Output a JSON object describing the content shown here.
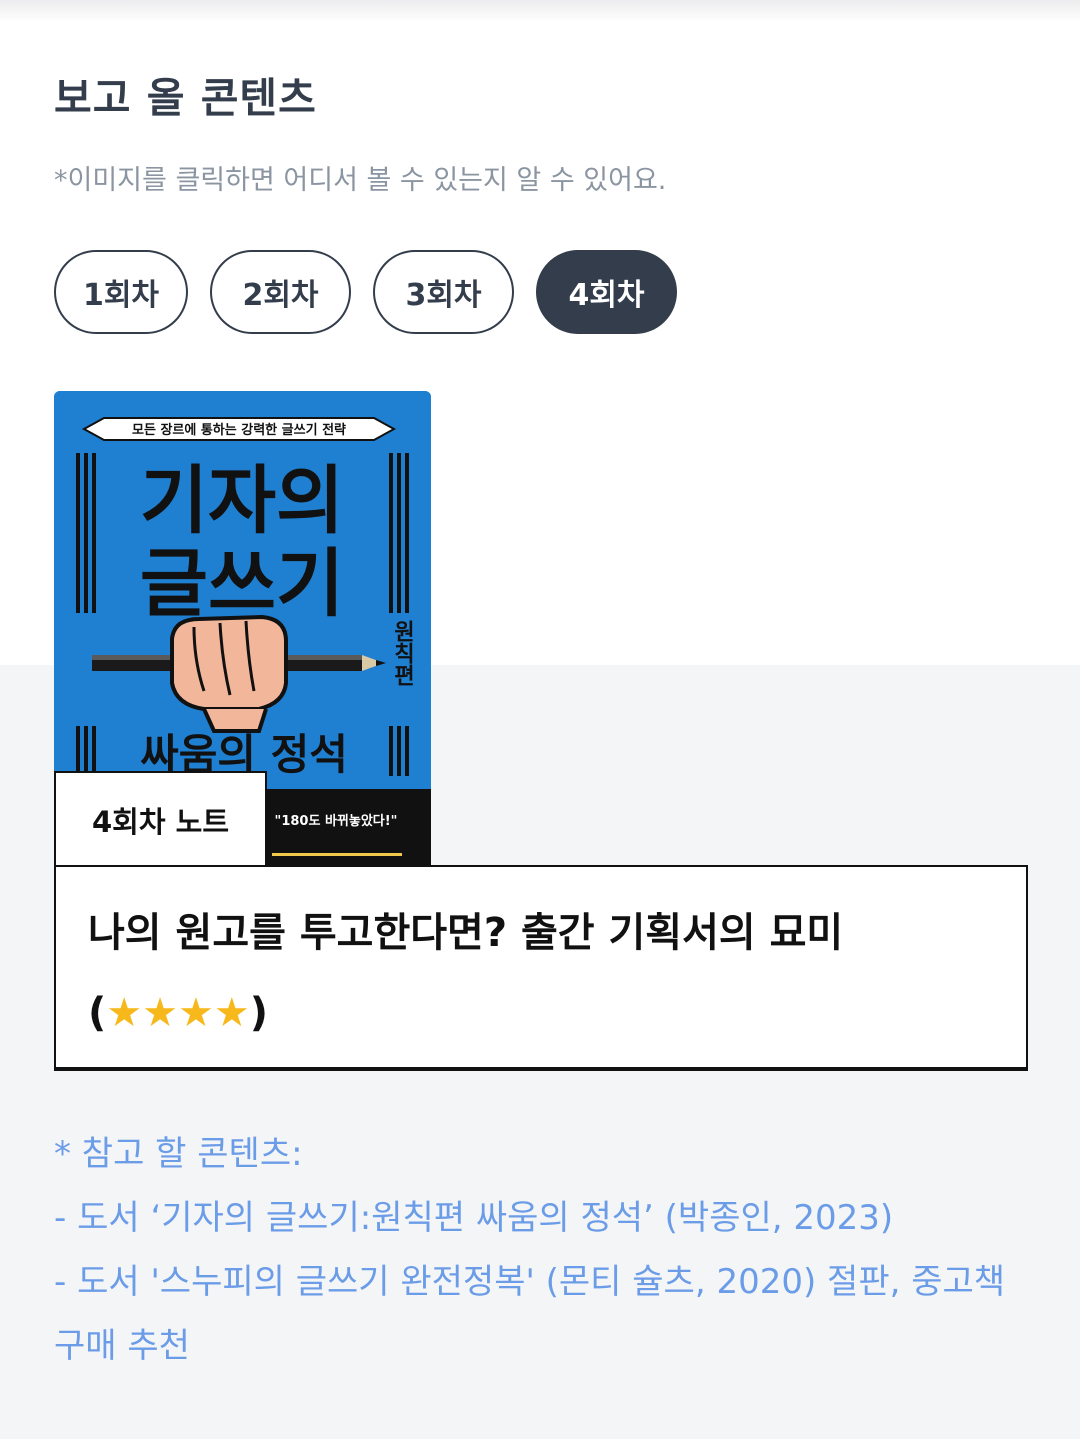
{
  "header": {
    "title": "보고 올 콘텐츠",
    "subtitle": "*이미지를 클릭하면 어디서 볼 수 있는지 알 수 있어요."
  },
  "tabs": [
    {
      "label": "1회차",
      "active": false
    },
    {
      "label": "2회차",
      "active": false
    },
    {
      "label": "3회차",
      "active": false
    },
    {
      "label": "4회차",
      "active": true
    }
  ],
  "book_cover": {
    "top_banner": "모든 장르에 통하는 강력한 글쓰기 전략",
    "title_line1": "기자의",
    "title_line2": "글쓰기",
    "side_label": "원칙편",
    "subtitle": "싸움의 정석",
    "quote": "\"180도 바뀌놓았다!\"",
    "background_color": "#1f7fd1"
  },
  "note": {
    "label": "4회차 노트",
    "title": "나의 원고를 투고한다면? 출간 기획서의 묘미",
    "rating_open": "(",
    "rating_stars": "★★★★",
    "rating_close": ")"
  },
  "references": {
    "heading": "* 참고 할 콘텐츠:",
    "items": [
      "- 도서 ‘기자의 글쓰기:원칙편 싸움의 정석’ (박종인, 2023)",
      "- 도서 '스누피의 글쓰기 완전정복' (몬티 슐츠, 2020) 절판, 중고책 구매 추천"
    ]
  },
  "colors": {
    "dark": "#333d4b",
    "subtitle_gray": "#8b95a1",
    "reference_blue": "#6b9ce8",
    "star": "#f6b81a",
    "section_bg": "#f4f5f7"
  }
}
